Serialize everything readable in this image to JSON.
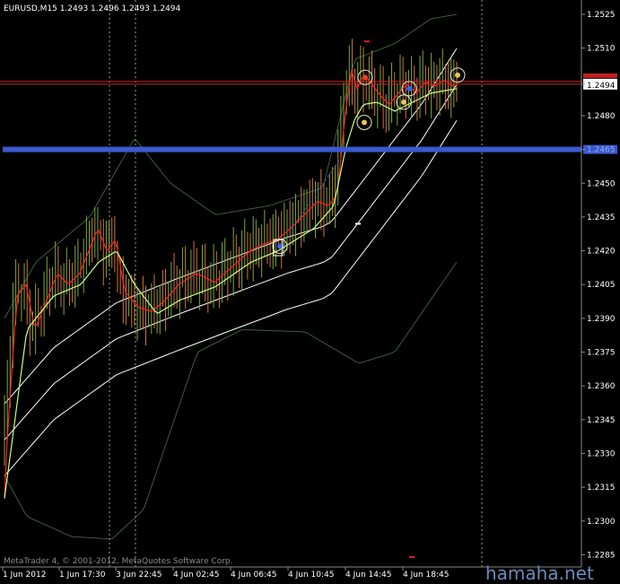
{
  "chart_data": {
    "type": "candlestick",
    "title": "EURUSD,M15  1.2493 1.2496 1.2493 1.2494",
    "symbol": "EURUSD",
    "timeframe": "M15",
    "ohlc_readout": [
      1.2493,
      1.2496,
      1.2493,
      1.2494
    ],
    "current_price_label": "1.2494",
    "current_price": 1.2494,
    "support_level_label": "1.2465",
    "support_level": 1.2465,
    "ylim": [
      1.2279,
      1.253
    ],
    "y_ticks": [
      "1.2525",
      "1.2510",
      "1.2494",
      "1.2480",
      "1.2465",
      "1.2450",
      "1.2435",
      "1.2420",
      "1.2405",
      "1.2390",
      "1.2375",
      "1.2360",
      "1.2345",
      "1.2330",
      "1.2315",
      "1.2300",
      "1.2285"
    ],
    "x_ticks": [
      "1 Jun 2012",
      "1 Jun 17:30",
      "3 Jun 22:45",
      "4 Jun 02:45",
      "4 Jun 06:45",
      "4 Jun 10:45",
      "4 Jun 14:45",
      "4 Jun 18:45"
    ],
    "session_separators": [
      "1 Jun 17:30",
      "3 Jun 22:45",
      "4 Jun 22:45"
    ],
    "grid": false,
    "footer_text": "MetaTrader 4, © 2001-2012, MetaQuotes Software Corp.",
    "watermark": "hamaha.net",
    "colors": {
      "background": "#000000",
      "bull": "#7ea83a",
      "bear": "#c8783e",
      "fast_ma": "#ff2020",
      "slow_ma": "#c8ff80",
      "channel": "#ffffff",
      "outer_band": "#3c5c3c",
      "support_line": "#3a5ad0",
      "current_line": "#c02020"
    }
  }
}
